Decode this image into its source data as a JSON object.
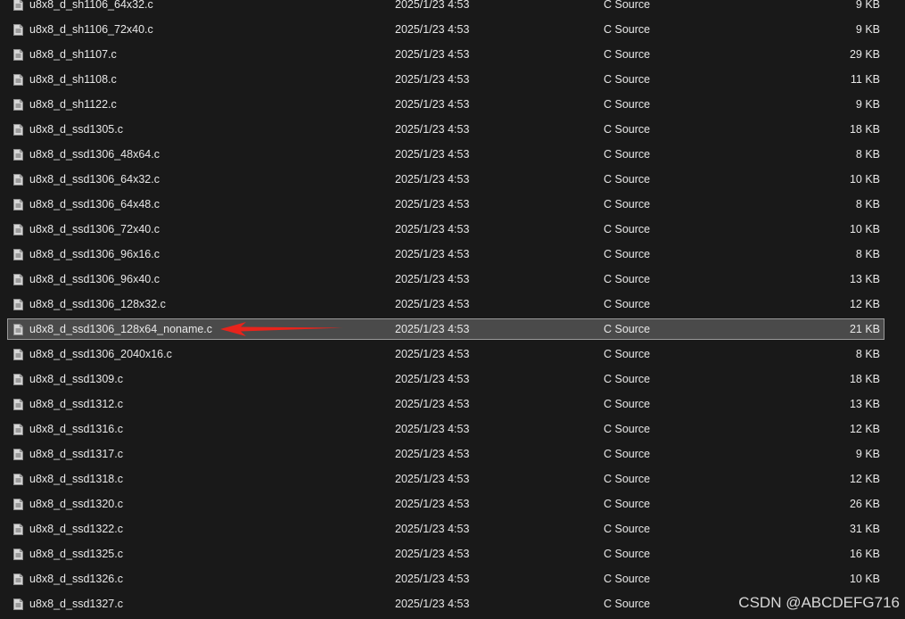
{
  "file_list": {
    "rows": [
      {
        "name": "u8x8_d_sh1106_64x32.c",
        "date": "2025/1/23 4:53",
        "type": "C Source",
        "size": "9 KB",
        "icon": "c-source-file-icon"
      },
      {
        "name": "u8x8_d_sh1106_72x40.c",
        "date": "2025/1/23 4:53",
        "type": "C Source",
        "size": "9 KB",
        "icon": "c-source-file-icon"
      },
      {
        "name": "u8x8_d_sh1107.c",
        "date": "2025/1/23 4:53",
        "type": "C Source",
        "size": "29 KB",
        "icon": "c-source-file-icon"
      },
      {
        "name": "u8x8_d_sh1108.c",
        "date": "2025/1/23 4:53",
        "type": "C Source",
        "size": "11 KB",
        "icon": "c-source-file-icon"
      },
      {
        "name": "u8x8_d_sh1122.c",
        "date": "2025/1/23 4:53",
        "type": "C Source",
        "size": "9 KB",
        "icon": "c-source-file-icon"
      },
      {
        "name": "u8x8_d_ssd1305.c",
        "date": "2025/1/23 4:53",
        "type": "C Source",
        "size": "18 KB",
        "icon": "c-source-file-icon"
      },
      {
        "name": "u8x8_d_ssd1306_48x64.c",
        "date": "2025/1/23 4:53",
        "type": "C Source",
        "size": "8 KB",
        "icon": "c-source-file-icon"
      },
      {
        "name": "u8x8_d_ssd1306_64x32.c",
        "date": "2025/1/23 4:53",
        "type": "C Source",
        "size": "10 KB",
        "icon": "c-source-file-icon"
      },
      {
        "name": "u8x8_d_ssd1306_64x48.c",
        "date": "2025/1/23 4:53",
        "type": "C Source",
        "size": "8 KB",
        "icon": "c-source-file-icon"
      },
      {
        "name": "u8x8_d_ssd1306_72x40.c",
        "date": "2025/1/23 4:53",
        "type": "C Source",
        "size": "10 KB",
        "icon": "c-source-file-icon"
      },
      {
        "name": "u8x8_d_ssd1306_96x16.c",
        "date": "2025/1/23 4:53",
        "type": "C Source",
        "size": "8 KB",
        "icon": "c-source-file-icon"
      },
      {
        "name": "u8x8_d_ssd1306_96x40.c",
        "date": "2025/1/23 4:53",
        "type": "C Source",
        "size": "13 KB",
        "icon": "c-source-file-icon"
      },
      {
        "name": "u8x8_d_ssd1306_128x32.c",
        "date": "2025/1/23 4:53",
        "type": "C Source",
        "size": "12 KB",
        "icon": "c-source-file-icon"
      },
      {
        "name": "u8x8_d_ssd1306_128x64_noname.c",
        "date": "2025/1/23 4:53",
        "type": "C Source",
        "size": "21 KB",
        "icon": "c-source-file-icon",
        "selected": true
      },
      {
        "name": "u8x8_d_ssd1306_2040x16.c",
        "date": "2025/1/23 4:53",
        "type": "C Source",
        "size": "8 KB",
        "icon": "c-source-file-icon"
      },
      {
        "name": "u8x8_d_ssd1309.c",
        "date": "2025/1/23 4:53",
        "type": "C Source",
        "size": "18 KB",
        "icon": "c-source-file-icon"
      },
      {
        "name": "u8x8_d_ssd1312.c",
        "date": "2025/1/23 4:53",
        "type": "C Source",
        "size": "13 KB",
        "icon": "c-source-file-icon"
      },
      {
        "name": "u8x8_d_ssd1316.c",
        "date": "2025/1/23 4:53",
        "type": "C Source",
        "size": "12 KB",
        "icon": "c-source-file-icon"
      },
      {
        "name": "u8x8_d_ssd1317.c",
        "date": "2025/1/23 4:53",
        "type": "C Source",
        "size": "9 KB",
        "icon": "c-source-file-icon"
      },
      {
        "name": "u8x8_d_ssd1318.c",
        "date": "2025/1/23 4:53",
        "type": "C Source",
        "size": "12 KB",
        "icon": "c-source-file-icon"
      },
      {
        "name": "u8x8_d_ssd1320.c",
        "date": "2025/1/23 4:53",
        "type": "C Source",
        "size": "26 KB",
        "icon": "c-source-file-icon"
      },
      {
        "name": "u8x8_d_ssd1322.c",
        "date": "2025/1/23 4:53",
        "type": "C Source",
        "size": "31 KB",
        "icon": "c-source-file-icon"
      },
      {
        "name": "u8x8_d_ssd1325.c",
        "date": "2025/1/23 4:53",
        "type": "C Source",
        "size": "16 KB",
        "icon": "c-source-file-icon"
      },
      {
        "name": "u8x8_d_ssd1326.c",
        "date": "2025/1/23 4:53",
        "type": "C Source",
        "size": "10 KB",
        "icon": "c-source-file-icon"
      },
      {
        "name": "u8x8_d_ssd1327.c",
        "date": "2025/1/23 4:53",
        "type": "C Source",
        "size": "",
        "icon": "c-source-file-icon"
      }
    ]
  },
  "annotation": {
    "icon": "red-arrow-icon",
    "color": "#e8241c"
  },
  "watermark": {
    "text": "CSDN @ABCDEFG716"
  },
  "colors": {
    "background": "#191919",
    "text": "#e8e8e8",
    "selected_background": "#4a4a4a",
    "selected_border": "#9a9a9a"
  }
}
